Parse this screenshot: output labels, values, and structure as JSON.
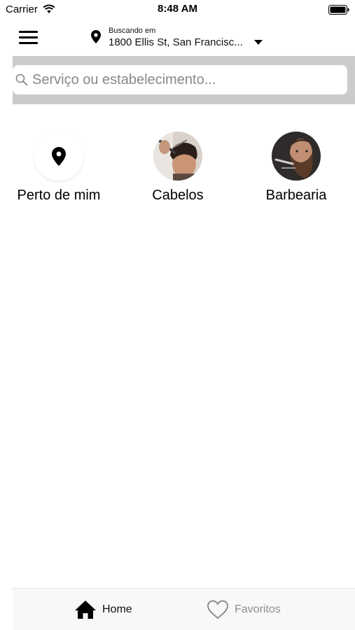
{
  "status_bar": {
    "carrier": "Carrier",
    "time": "8:48 AM"
  },
  "header": {
    "location_caption": "Buscando em",
    "location_address": "1800 Ellis St, San Francisc..."
  },
  "search": {
    "placeholder": "Serviço ou estabelecimento..."
  },
  "categories": [
    {
      "label": "Perto de mim",
      "icon": "location-pin-icon"
    },
    {
      "label": "Cabelos",
      "icon": "haircut-photo"
    },
    {
      "label": "Barbearia",
      "icon": "barber-photo"
    }
  ],
  "tabs": [
    {
      "label": "Home",
      "icon": "home-icon",
      "active": true
    },
    {
      "label": "Favoritos",
      "icon": "heart-icon",
      "active": false
    }
  ],
  "colors": {
    "search_band": "#cbcbcb",
    "tab_inactive": "#8e8e8e",
    "tab_bar_bg": "#f8f8f8"
  }
}
